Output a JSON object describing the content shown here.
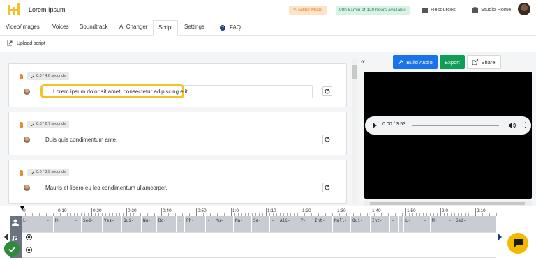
{
  "header": {
    "brand": "Lorem Ipsum",
    "editor_mode": "✎ Editor Mode",
    "hours_available": "98h 51min of 120 hours available",
    "resources": "Resources",
    "studio_home": "Studio Home"
  },
  "nav": {
    "tabs": [
      "Video/Images",
      "Voices",
      "Soundtrack",
      "AI Changer",
      "Script",
      "Settings"
    ],
    "faq": "FAQ",
    "active": "Script"
  },
  "upload": {
    "label": "Upload script"
  },
  "script_lines": [
    {
      "duration": "0.0 / 4.6 seconds",
      "text": "Lorem ipsum dolor sit amet, consectetur adipiscing elit."
    },
    {
      "duration": "0.0 / 2.7 seconds",
      "text": "Duis quis condimentum ante."
    },
    {
      "duration": "0.0 / 3.9 seconds",
      "text": "Mauris et libero eu leo condimentum ullamcorper."
    }
  ],
  "actions": {
    "collapse": "«",
    "build_audio": "Build Audio",
    "export": "Export",
    "share": "Share"
  },
  "player": {
    "time": "0:00 / 3:53",
    "progress": 0.0
  },
  "timeline": {
    "ticks": [
      "0",
      "0:10",
      "0:20",
      "0:30",
      "0:40",
      "0:50",
      "1:0",
      "1:10",
      "1:20",
      "1:30",
      "1:40",
      "1:50",
      "2:0",
      "2:10"
    ],
    "clips": [
      "L-",
      "-",
      "M-",
      "-",
      "Sed-",
      "Ves-",
      "Qui-",
      "Nu-",
      "Do-",
      "-",
      "Ph-",
      "-",
      "Mu-",
      "Na-",
      "Se-",
      "-",
      "Ali-",
      "P-",
      "Int-",
      "Null-",
      "Qui-",
      "Int-",
      "-",
      "-",
      "L-",
      "-",
      "M-",
      "-",
      "Sed-"
    ]
  },
  "colors": {
    "primary_blue": "#1a73e8",
    "export_green": "#0f9d58",
    "highlight_yellow": "#f3c22b",
    "editor_orange": "#e98a2e"
  }
}
